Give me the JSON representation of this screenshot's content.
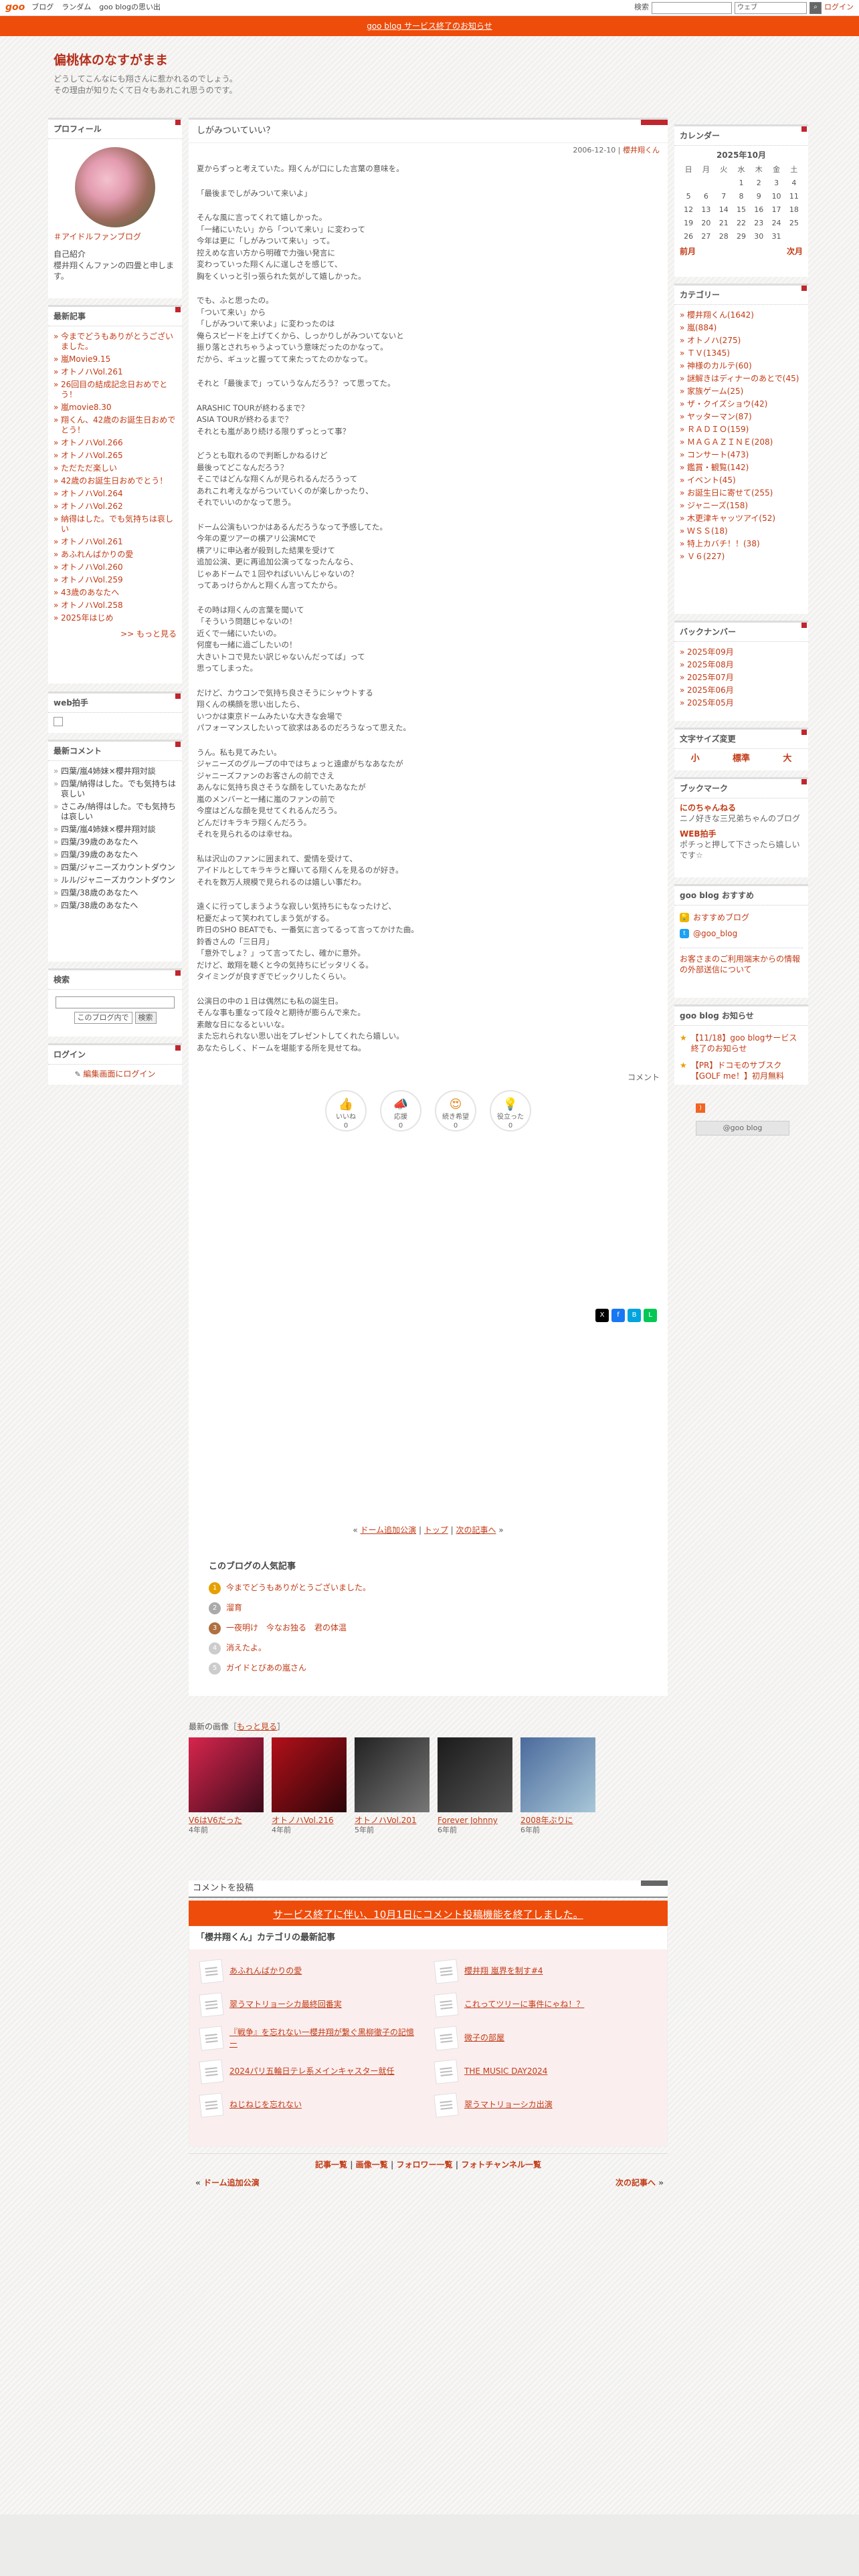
{
  "topbar": {
    "logo": "goo",
    "links": [
      "ブログ",
      "ランダム",
      "goo blogの思い出"
    ],
    "search_label": "検索",
    "search_type": "ウェブ",
    "login": "ログイン"
  },
  "notice": "goo blog サービス終了のお知らせ",
  "blog": {
    "title": "偏桃体のなすがまま",
    "description_lines": [
      "どうしてこんなにも翔さんに惹かれるのでしょう。",
      "その理由が知りたくて日々もあれこれ思うのです。"
    ]
  },
  "profile": {
    "heading": "プロフィール",
    "link": "＃アイドルファンブログ",
    "intro_label": "自己紹介",
    "intro": "櫻井翔くんファンの四畳と申します。"
  },
  "recent_posts": {
    "heading": "最新記事",
    "items": [
      "今までどうもありがとうございました。",
      "嵐Movie9.15",
      "オトノハVol.261",
      "26回目の結成記念日おめでとう！",
      "嵐movie8.30",
      "翔くん、42歳のお誕生日おめでとう！",
      "オトノハVol.266",
      "オトノハVol.265",
      "ただただ楽しい",
      "42歳のお誕生日おめでとう！",
      "オトノハVol.264",
      "オトノハVol.262",
      "納得はした。でも気持ちは哀しい",
      "オトノハVol.261",
      "あふれんばかりの愛",
      "オトノハVol.260",
      "オトノハVol.259",
      "43歳のあなたへ",
      "オトノハVol.258",
      "2025年はじめ"
    ],
    "more": ">> もっと見る"
  },
  "web_clap": {
    "heading": "web拍手"
  },
  "recent_comments": {
    "heading": "最新コメント",
    "items": [
      "四葉/嵐4姉妹×櫻井翔対談",
      "四葉/納得はした。でも気持ちは哀しい",
      "さこみ/納得はした。でも気持ちは哀しい",
      "四葉/嵐4姉妹×櫻井翔対談",
      "四葉/39歳のあなたへ",
      "四葉/39歳のあなたへ",
      "四葉/ジャニーズカウントダウン",
      "ルル/ジャニーズカウントダウン",
      "四葉/38歳のあなたへ",
      "四葉/38歳のあなたへ"
    ]
  },
  "search": {
    "heading": "検索",
    "scope": "このブログ内で",
    "button": "検索"
  },
  "login": {
    "heading": "ログイン",
    "link": "編集画面にログイン"
  },
  "post": {
    "title": "しがみついていい？",
    "date": "2006-12-10",
    "category": "櫻井翔くん",
    "paragraphs": [
      "夏からずっと考えていた。翔くんが口にした言葉の意味を。",
      "「最後までしがみついて来いよ」",
      "そんな風に言ってくれて嬉しかった。\n「一緒にいたい」から「ついて来い」に変わって\n今年は更に「しがみついて来い」って。\n控えめな言い方から明確で力強い発言に\n変わっていった翔くんに逞しさを感じて、\n胸をくいっと引っ張られた気がして嬉しかった。",
      "でも、ふと思ったの。\n「ついて来い」から\n「しがみついて来いよ」に変わったのは\n俺らスピードを上げてくから、しっかりしがみついてないと\n振り落とされちゃうよっていう意味だったのかなって。\nだから、ギュッと握ってて来たってたのかなって。",
      "それと「最後まで」っていうなんだろう？って思ってた。",
      "ARASHIC TOURが終わるまで？\nASIA TOURが終わるまで？\nそれとも嵐があり続ける限りずっとって事？",
      "どうとも取れるので判断しかねるけど\n最後ってどこなんだろう？\nそこではどんな翔くんが見られるんだろうって\nあれこれ考えながらついていくのが楽しかったり、\nそれでいいのかなって思う。",
      "ドーム公演もいつかはあるんだろうなって予感してた。\n今年の夏ツアーの横アリ公演MCで\n横アリに申込者が殺到した結果を受けて\n追加公演、更に再追加公演ってなったんなら、\nじゃあドームで１回やればいいんじゃないの？\nってあっけらかんと翔くん言ってたから。",
      "その時は翔くんの言葉を聞いて\n「そういう問題じゃないの！\n近くで一緒にいたいの。\n何度も一緒に過ごしたいの！\n大きいトコで見たい訳じゃないんだってば」って\n思ってしまった。",
      "だけど、カウコンで気持ち良さそうにシャウトする\n翔くんの横顔を思い出したら、\nいつかは東京ドームみたいな大きな会場で\nパフォーマンスしたいって欲求はあるのだろうなって思えた。",
      "うん。私も見てみたい。\nジャニーズのグループの中ではちょっと遠慮がちなあなたが\nジャニーズファンのお客さんの前でさえ\nあんなに気持ち良さそうな顔をしていたあなたが\n嵐のメンバーと一緒に嵐のファンの前で\n今度はどんな顔を見せてくれるんだろう。\nどんだけキラキラ翔くんだろう。\nそれを見られるのは幸せね。",
      "私は沢山のファンに囲まれて、愛情を受けて、\nアイドルとしてキラキラと輝いてる翔くんを見るのが好き。\nそれを数万人規模で見られるのは嬉しい事だわ。",
      "遠くに行ってしまうような寂しい気持ちにもなったけど、\n杞憂だよって笑われてしまう気がする。\n昨日のSHO BEATでも、一番気に言ってるって言ってかけた曲。\n鈴香さんの「三日月」\n「意外でしょ？」って言ってたし、確かに意外。\nだけど、敢翔を聴くと今の気持ちにピッタリくる。\nタイミングが良すぎでビックリしたくらい。",
      "公演日の中の１日は偶然にも私の誕生日。\nそんな事も重なって段々と期待が膨らんで来た。\n素敵な日になるといいな。\nまた忘れられない思い出をプレゼントしてくれたら嬉しい。\nあなたらしく、ドームを堪能する所を見せてね。"
    ],
    "comment_label": "コメント",
    "reactions": [
      {
        "label": "いいね",
        "count": "0"
      },
      {
        "label": "応援",
        "count": "0"
      },
      {
        "label": "続き希望",
        "count": "0"
      },
      {
        "label": "役立った",
        "count": "0"
      }
    ]
  },
  "nav": {
    "prev": "ドーム追加公演",
    "top": "トップ",
    "next": "次の記事へ"
  },
  "popular": {
    "heading": "このブログの人気記事",
    "items": [
      "今までどうもありがとうございました。",
      "溜育",
      "一夜明け　今なお独る　君の体温",
      "消えたよ。",
      "ガイドとびあの嵐さん"
    ]
  },
  "recent_images": {
    "heading": "最新の画像",
    "more": "もっと見る",
    "items": [
      {
        "title": "V6はV6だった",
        "age": "4年前"
      },
      {
        "title": "オトノハVol.216",
        "age": "4年前"
      },
      {
        "title": "オトノハVol.201",
        "age": "5年前"
      },
      {
        "title": "Forever Johnny",
        "age": "6年前"
      },
      {
        "title": "2008年ぶりに",
        "age": "6年前"
      }
    ]
  },
  "comment_post": {
    "heading": "コメントを投稿",
    "ended": "サービス終了に伴い、10月1日にコメント投稿機能を終了しました。"
  },
  "category_latest": {
    "heading": "「櫻井翔くん」カテゴリの最新記事",
    "items": [
      "あふれんばかりの愛",
      "櫻井翔 嵐界を制す#4",
      "翠うマトリョーシカ最終回番実",
      "これってツリーに事件にゃね！？",
      "『戦争』を忘れない一櫻井翔が繋ぐ黒柳徹子の記憶ー",
      "微子の部屋",
      "2024パリ五輪日テレ系メインキャスター就任",
      "THE MUSIC DAY2024",
      "ねじねじを忘れない",
      "翠うマトリョーシカ出演"
    ]
  },
  "footer": {
    "links": [
      "記事一覧",
      "画像一覧",
      "フォロワー一覧",
      "フォトチャンネル一覧"
    ],
    "prev": "ドーム追加公演",
    "next": "次の記事へ"
  },
  "calendar": {
    "heading": "カレンダー",
    "month": "2025年10月",
    "weekdays": [
      "日",
      "月",
      "火",
      "水",
      "木",
      "金",
      "土"
    ],
    "days": [
      "",
      "",
      "",
      "1",
      "2",
      "3",
      "4",
      "5",
      "6",
      "7",
      "8",
      "9",
      "10",
      "11",
      "12",
      "13",
      "14",
      "15",
      "16",
      "17",
      "18",
      "19",
      "20",
      "21",
      "22",
      "23",
      "24",
      "25",
      "26",
      "27",
      "28",
      "29",
      "30",
      "31",
      ""
    ],
    "prev": "前月",
    "next": "次月"
  },
  "categories": {
    "heading": "カテゴリー",
    "items": [
      "櫻井翔くん(1642)",
      "嵐(884)",
      "オトノハ(275)",
      "ＴＶ(1345)",
      "神様のカルテ(60)",
      "謎解きはディナーのあとで(45)",
      "家族ゲーム(25)",
      "ザ・クイズショウ(42)",
      "ヤッターマン(87)",
      "ＲＡＤＩＯ(159)",
      "ＭＡＧＡＺＩＮＥ(208)",
      "コンサート(473)",
      "鑑賞・観覧(142)",
      "イベント(45)",
      "お誕生日に寄せて(255)",
      "ジャニーズ(158)",
      "木更津キャッツアイ(52)",
      "ＷＳＳ(18)",
      "特上カバチ！！(38)",
      "Ｖ６(227)"
    ]
  },
  "backnumber": {
    "heading": "バックナンバー",
    "items": [
      "2025年09月",
      "2025年08月",
      "2025年07月",
      "2025年06月",
      "2025年05月"
    ]
  },
  "font_size": {
    "heading": "文字サイズ変更",
    "items": [
      "小",
      "標準",
      "大"
    ]
  },
  "bookmark": {
    "heading": "ブックマーク",
    "items": [
      {
        "title": "にのちゃんねる",
        "desc": "ニノ好きな三兄弟ちゃんのブログ"
      },
      {
        "title": "WEB拍手",
        "desc": "ポチっと押して下さったら嬉しいです☆"
      }
    ]
  },
  "goo_recommend": {
    "heading": "goo blog おすすめ",
    "items": [
      "おすすめブログ",
      "@goo_blog"
    ],
    "link": "お客さまのご利用端末からの情報の外部送信について"
  },
  "goo_notice": {
    "heading": "goo blog お知らせ",
    "items": [
      "【11/18】goo blogサービス終了のお知らせ",
      "【PR】ドコモのサブスク【GOLF me！】初月無料"
    ],
    "badge": "@goo blog"
  },
  "colors": {
    "accent": "#c23b16",
    "notice_bg": "#ee4c0b",
    "corner": "#c0262d"
  }
}
